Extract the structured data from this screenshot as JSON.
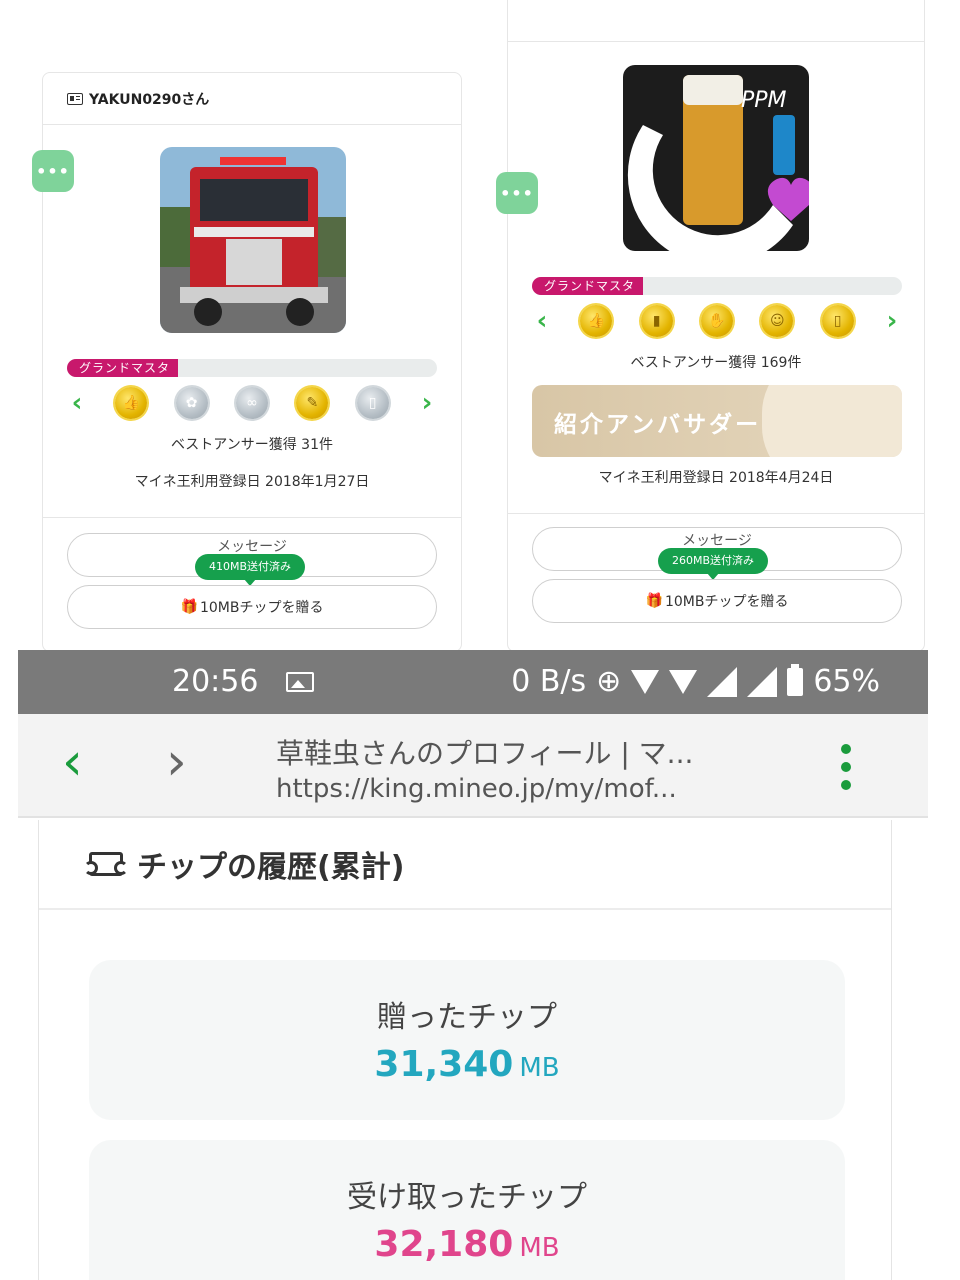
{
  "card1": {
    "username": "YAKUN0290さん",
    "rank_label": "グランドマスタ",
    "best_answers": "ベストアンサー獲得 31件",
    "registered": "マイネ王利用登録日 2018年1月27日",
    "message_label": "メッセージ",
    "tip_sent_bubble": "410MB送付済み",
    "gift_label": "10MBチップを贈る",
    "badges": [
      "gold",
      "grey",
      "grey",
      "gold",
      "grey"
    ]
  },
  "card2": {
    "rank_label": "グランドマスタ",
    "best_answers": "ベストアンサー獲得 169件",
    "ambassador": "紹介アンバサダー",
    "registered": "マイネ王利用登録日 2018年4月24日",
    "message_label": "メッセージ",
    "tip_sent_bubble": "260MB送付済み",
    "gift_label": "10MBチップを贈る",
    "badges": [
      "gold",
      "gold",
      "gold",
      "gold",
      "gold"
    ]
  },
  "statusbar": {
    "time": "20:56",
    "speed": "0 B/s",
    "battery": "65%",
    "sim1": "1",
    "sim2": "2"
  },
  "browser": {
    "title": "草鞋虫さんのプロフィール | マ...",
    "url": "https://king.mineo.jp/my/mof..."
  },
  "tip_history": {
    "heading": "チップの履歴(累計)",
    "sent_label": "贈ったチップ",
    "sent_value": "31,340",
    "sent_unit": "MB",
    "received_label": "受け取ったチップ",
    "received_value": "32,180",
    "received_unit": "MB"
  },
  "colors": {
    "accent_green": "#16a04d",
    "rank_magenta": "#c8186c",
    "sent_teal": "#23a7bf",
    "received_pink": "#e0458c"
  }
}
